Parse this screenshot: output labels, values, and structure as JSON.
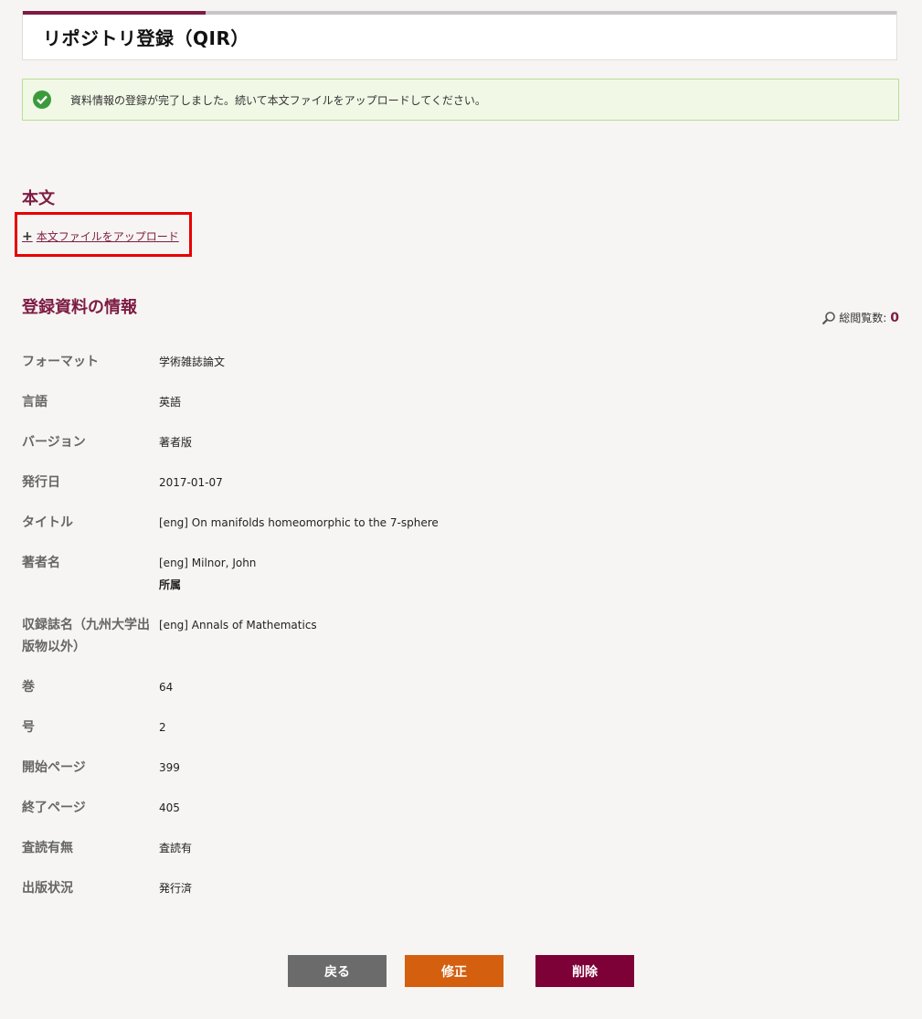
{
  "page_title": "リポジトリ登録（QIR）",
  "alert": {
    "message": "資料情報の登録が完了しました。続いて本文ファイルをアップロードしてください。"
  },
  "fulltext_section": {
    "heading": "本文",
    "upload_link": "本文ファイルをアップロード"
  },
  "info_section": {
    "heading": "登録資料の情報",
    "views_label": "総閲覧数:",
    "views_count": "0"
  },
  "metadata": [
    {
      "label": "フォーマット",
      "value": "学術雑誌論文"
    },
    {
      "label": "言語",
      "value": "英語"
    },
    {
      "label": "バージョン",
      "value": "著者版"
    },
    {
      "label": "発行日",
      "value": "2017-01-07"
    },
    {
      "label": "タイトル",
      "value": "[eng] On manifolds homeomorphic to the 7-sphere"
    },
    {
      "label": "著者名",
      "value": "[eng] Milnor, John",
      "sub": "所属"
    },
    {
      "label": "収録誌名（九州大学出版物以外）",
      "value": "[eng] Annals of Mathematics"
    },
    {
      "label": "巻",
      "value": "64"
    },
    {
      "label": "号",
      "value": "2"
    },
    {
      "label": "開始ページ",
      "value": "399"
    },
    {
      "label": "終了ページ",
      "value": "405"
    },
    {
      "label": "査読有無",
      "value": "査読有"
    },
    {
      "label": "出版状況",
      "value": "発行済"
    }
  ],
  "buttons": {
    "back": "戻る",
    "edit": "修正",
    "delete": "削除"
  },
  "colors": {
    "accent": "#7d1c43",
    "back_button": "#6b6b6b",
    "edit_button": "#d35f0f",
    "delete_button": "#7d0036",
    "alert_bg": "#f1f8e6",
    "highlight_box": "#e60000"
  }
}
